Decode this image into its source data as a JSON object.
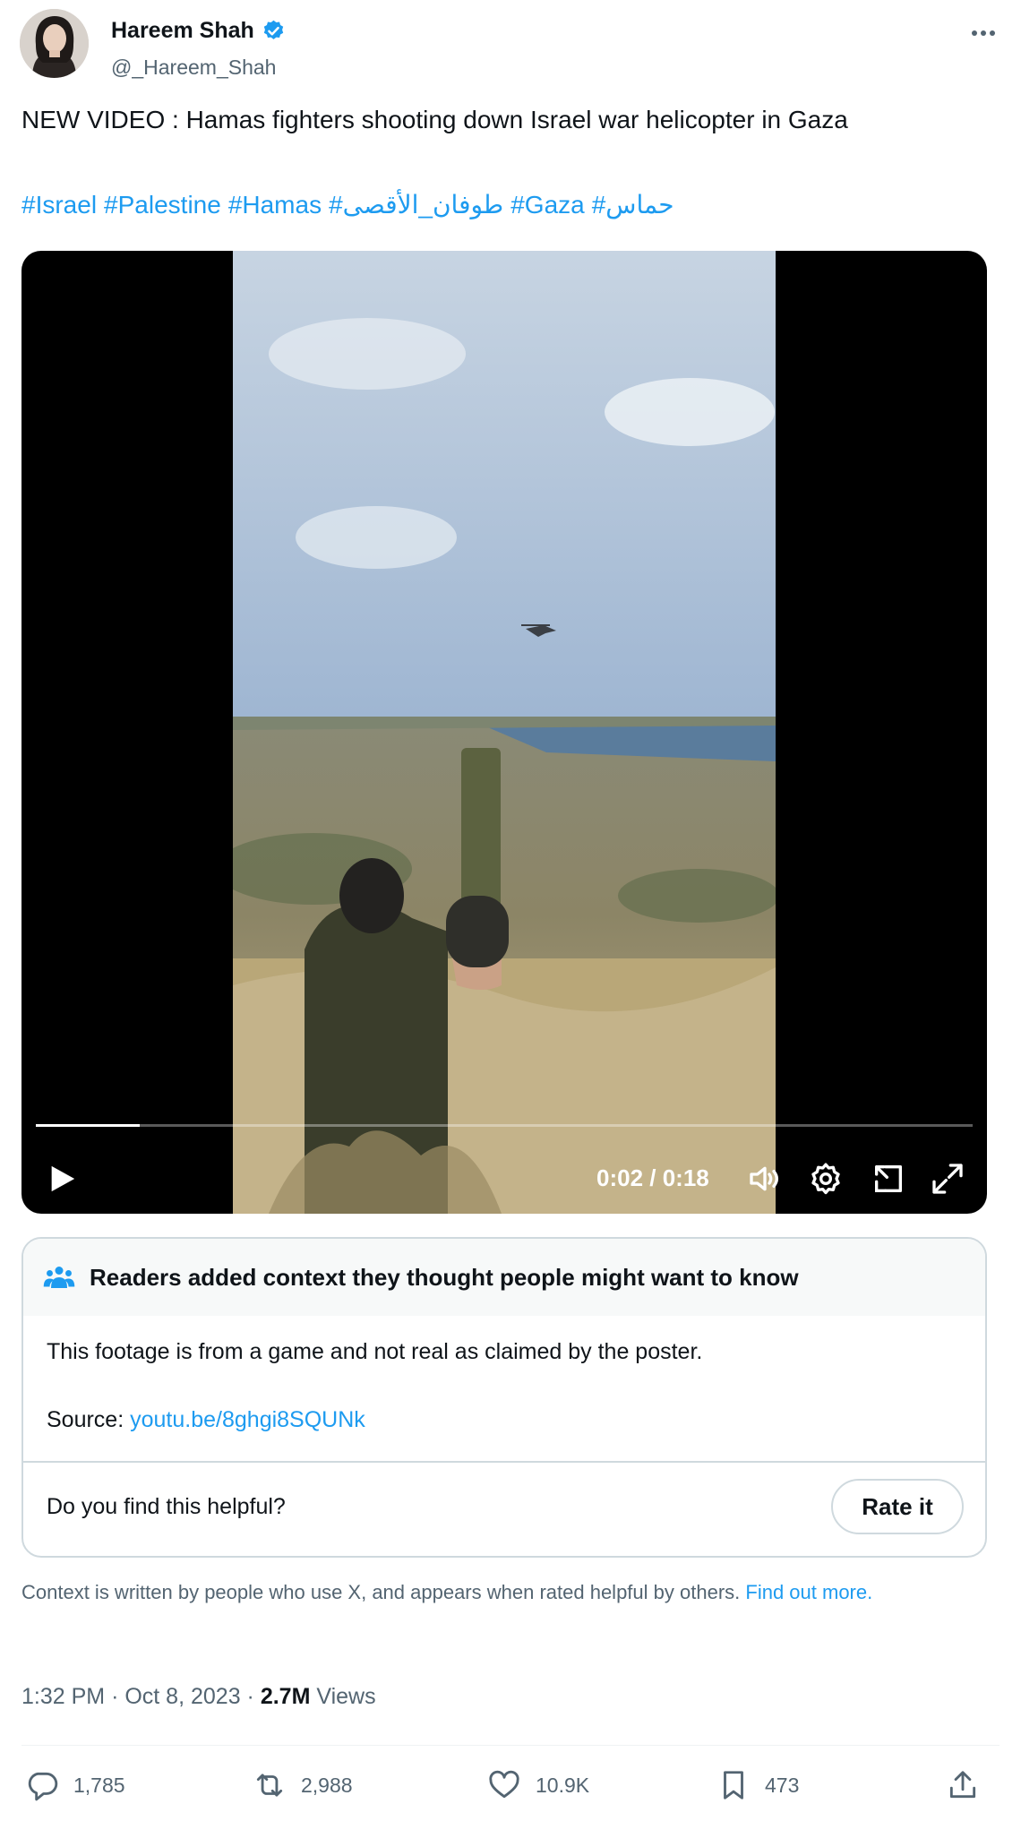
{
  "author": {
    "display_name": "Hareem Shah",
    "handle": "@_Hareem_Shah",
    "verified_color": "#1d9bf0"
  },
  "tweet": {
    "text": "NEW VIDEO : Hamas fighters shooting down Israel war helicopter in Gaza",
    "hashtags": [
      "#Israel",
      "#Palestine",
      "#Hamas",
      "#طوفان_الأقصى",
      "#Gaza",
      "#حماس"
    ]
  },
  "video": {
    "time_display": "0:02 / 0:18",
    "progress_fraction": 0.111
  },
  "community_note": {
    "title": "Readers added context they thought people might want to know",
    "body": "This footage is from a game and not real as claimed by the poster.",
    "source_label": "Source:",
    "source_link": "youtu.be/8ghgi8SQUNk",
    "question": "Do you find this helpful?",
    "rate_button": "Rate it"
  },
  "context_footer": {
    "text": "Context is written by people who use X, and appears when rated helpful by others.",
    "link": "Find out more."
  },
  "meta": {
    "time": "1:32 PM",
    "separator": "·",
    "date": "Oct 8, 2023",
    "views_count": "2.7M",
    "views_label": "Views"
  },
  "actions": {
    "replies": "1,785",
    "reposts": "2,988",
    "likes": "10.9K",
    "bookmarks": "473"
  },
  "icons": [
    "verified-badge-icon",
    "more-icon",
    "play-icon",
    "volume-icon",
    "settings-icon",
    "pip-icon",
    "fullscreen-icon",
    "community-notes-icon",
    "reply-icon",
    "repost-icon",
    "like-icon",
    "bookmark-icon",
    "share-icon"
  ]
}
